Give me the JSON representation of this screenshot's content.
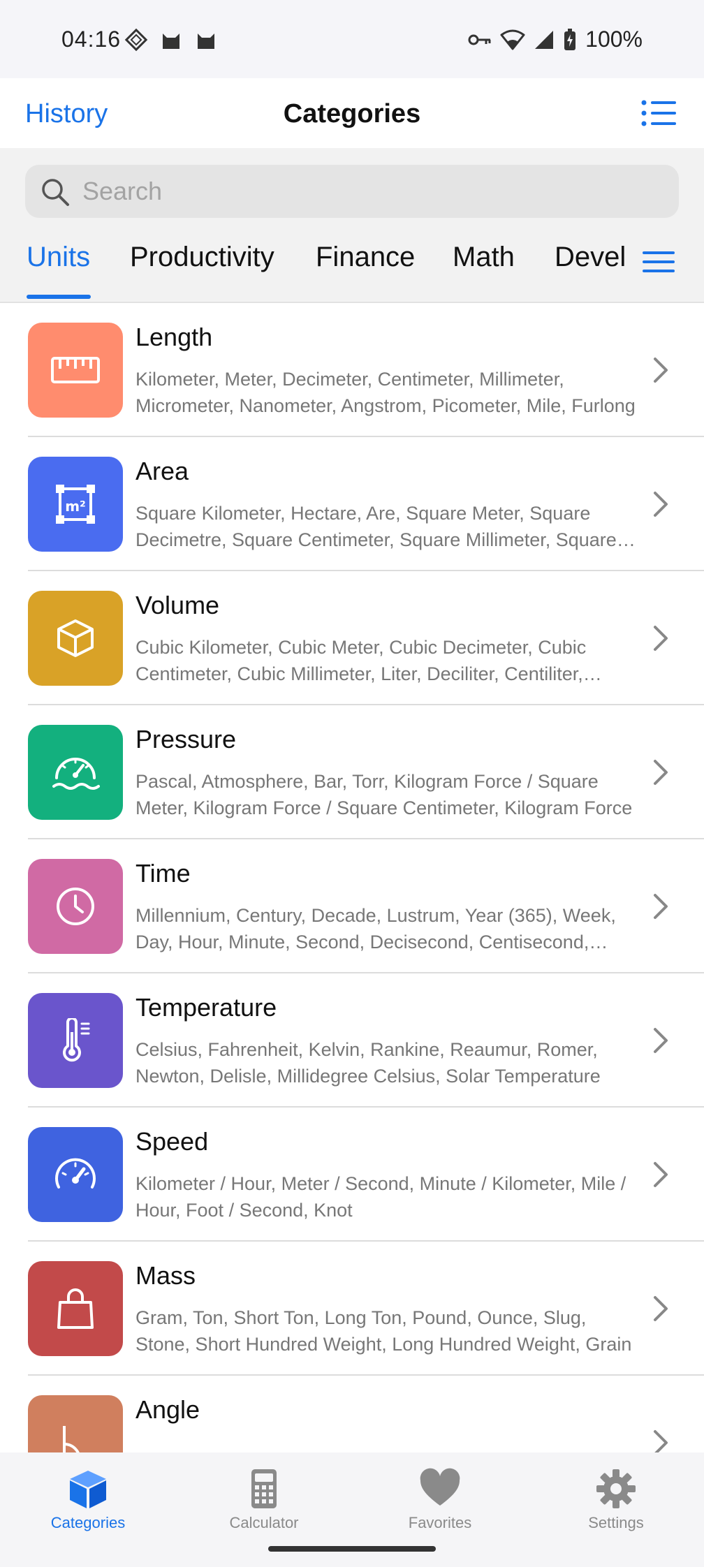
{
  "status_bar": {
    "time": "04:16",
    "battery": "100%",
    "left_icons": [
      "diamond-icon",
      "cat-icon",
      "cat-icon"
    ],
    "right_icons": [
      "vpn-key-icon",
      "wifi-icon",
      "signal-icon",
      "battery-icon"
    ]
  },
  "navbar": {
    "left_link": "History",
    "title": "Categories",
    "right_icon": "list-icon"
  },
  "search": {
    "placeholder": "Search",
    "value": ""
  },
  "tabs": {
    "items": [
      {
        "label": "Units",
        "active": true
      },
      {
        "label": "Productivity",
        "active": false
      },
      {
        "label": "Finance",
        "active": false
      },
      {
        "label": "Math",
        "active": false
      },
      {
        "label": "Devel",
        "active": false
      }
    ],
    "menu_icon": "hamburger-icon"
  },
  "categories": [
    {
      "title": "Length",
      "icon": "ruler-icon",
      "color": "#FF8C6E",
      "desc": "Kilometer, Meter, Decimeter, Centimeter, Millimeter, Micrometer, Nanometer, Angstrom, Picometer, Mile, Furlong"
    },
    {
      "title": "Area",
      "icon": "square-meter-icon",
      "color": "#4A6CF0",
      "desc": "Square Kilometer, Hectare, Are, Square Meter, Square Decimetre, Square Centimeter, Square Millimeter, Square Micrometer"
    },
    {
      "title": "Volume",
      "icon": "cube-icon",
      "color": "#D9A227",
      "desc": "Cubic Kilometer, Cubic Meter, Cubic Decimeter, Cubic Centimeter, Cubic Millimeter, Liter, Deciliter, Centiliter, Milliliter"
    },
    {
      "title": "Pressure",
      "icon": "pressure-gauge-icon",
      "color": "#13B07E",
      "desc": "Pascal, Atmosphere, Bar, Torr, Kilogram Force / Square Meter, Kilogram Force / Square Centimeter, Kilogram Force"
    },
    {
      "title": "Time",
      "icon": "clock-icon",
      "color": "#D06AA4",
      "desc": "Millennium, Century, Decade, Lustrum, Year (365), Week, Day, Hour, Minute, Second, Decisecond, Centisecond, Millisecond"
    },
    {
      "title": "Temperature",
      "icon": "thermometer-icon",
      "color": "#6A55CC",
      "desc": "Celsius, Fahrenheit, Kelvin, Rankine, Reaumur, Romer, Newton, Delisle, Millidegree Celsius, Solar Temperature"
    },
    {
      "title": "Speed",
      "icon": "speedometer-icon",
      "color": "#3F63E0",
      "desc": "Kilometer / Hour, Meter / Second, Minute / Kilometer, Mile / Hour, Foot / Second, Knot"
    },
    {
      "title": "Mass",
      "icon": "shopping-bag-icon",
      "color": "#C24A4A",
      "desc": "Gram, Ton, Short Ton, Long Ton, Pound, Ounce, Slug, Stone, Short Hundred Weight, Long Hundred Weight, Grain"
    },
    {
      "title": "Angle",
      "icon": "angle-icon",
      "color": "#D07F5E",
      "desc": ""
    }
  ],
  "bottom_nav": [
    {
      "label": "Categories",
      "icon": "cube-icon",
      "active": true
    },
    {
      "label": "Calculator",
      "icon": "calculator-icon",
      "active": false
    },
    {
      "label": "Favorites",
      "icon": "heart-icon",
      "active": false
    },
    {
      "label": "Settings",
      "icon": "gear-icon",
      "active": false
    }
  ],
  "colors": {
    "accent": "#1A73E8",
    "inactive": "#8A8A8A"
  }
}
